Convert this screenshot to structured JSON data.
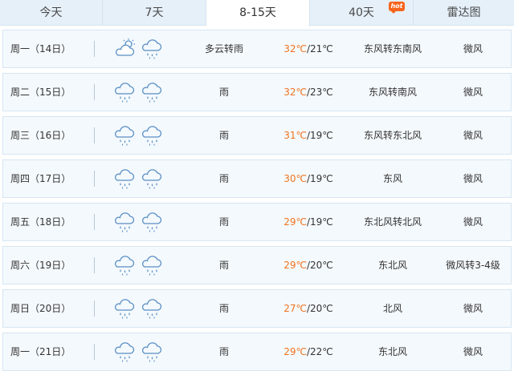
{
  "tabs": [
    {
      "label": "今天"
    },
    {
      "label": "7天"
    },
    {
      "label": "8-15天"
    },
    {
      "label": "40天",
      "badge": "hot"
    },
    {
      "label": "雷达图"
    }
  ],
  "active_tab": 2,
  "colors": {
    "accent_temp": "#f0731e",
    "row_bg": "#f4f9fd",
    "row_border": "#d6e6f3",
    "tab_bar": "#e6f0f9"
  },
  "forecast": [
    {
      "day": "周一（14日）",
      "icons": [
        "partly-cloudy-sun-icon",
        "rain-cloud-icon"
      ],
      "condition": "多云转雨",
      "high": "32℃",
      "low": "/21℃",
      "wind_dir": "东风转东南风",
      "wind_force": "微风"
    },
    {
      "day": "周二（15日）",
      "icons": [
        "rain-cloud-icon",
        "rain-cloud-icon"
      ],
      "condition": "雨",
      "high": "32℃",
      "low": "/23℃",
      "wind_dir": "东风转南风",
      "wind_force": "微风"
    },
    {
      "day": "周三（16日）",
      "icons": [
        "rain-cloud-icon",
        "rain-cloud-icon"
      ],
      "condition": "雨",
      "high": "31℃",
      "low": "/19℃",
      "wind_dir": "东风转东北风",
      "wind_force": "微风"
    },
    {
      "day": "周四（17日）",
      "icons": [
        "rain-cloud-icon",
        "rain-cloud-icon"
      ],
      "condition": "雨",
      "high": "30℃",
      "low": "/19℃",
      "wind_dir": "东风",
      "wind_force": "微风"
    },
    {
      "day": "周五（18日）",
      "icons": [
        "rain-cloud-icon",
        "rain-cloud-icon"
      ],
      "condition": "雨",
      "high": "29℃",
      "low": "/19℃",
      "wind_dir": "东北风转北风",
      "wind_force": "微风"
    },
    {
      "day": "周六（19日）",
      "icons": [
        "rain-cloud-icon",
        "rain-cloud-icon"
      ],
      "condition": "雨",
      "high": "29℃",
      "low": "/20℃",
      "wind_dir": "东北风",
      "wind_force": "微风转3-4级"
    },
    {
      "day": "周日（20日）",
      "icons": [
        "rain-cloud-icon",
        "rain-cloud-icon"
      ],
      "condition": "雨",
      "high": "27℃",
      "low": "/20℃",
      "wind_dir": "北风",
      "wind_force": "微风"
    },
    {
      "day": "周一（21日）",
      "icons": [
        "rain-cloud-icon",
        "rain-cloud-icon"
      ],
      "condition": "雨",
      "high": "29℃",
      "low": "/22℃",
      "wind_dir": "东北风",
      "wind_force": "微风"
    }
  ]
}
